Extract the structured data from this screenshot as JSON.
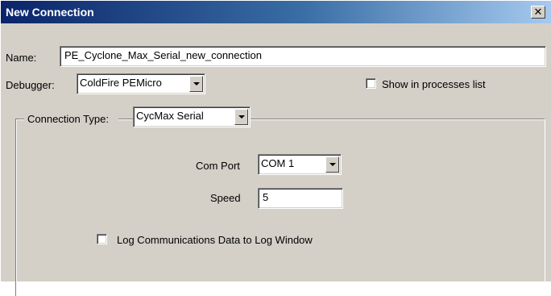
{
  "window": {
    "title": "New Connection",
    "close_glyph": "✕",
    "close_icon": "close-icon"
  },
  "form": {
    "name_label": "Name:",
    "name_value": "PE_Cyclone_Max_Serial_new_connection",
    "debugger_label": "Debugger:",
    "debugger_value": "ColdFire PEMicro",
    "show_in_processes_label": "Show in processes list",
    "show_in_processes_checked": false,
    "connection_type_label": "Connection Type:",
    "connection_type_value": "CycMax Serial",
    "com_port_label": "Com Port",
    "com_port_value": "COM 1",
    "speed_label": "Speed",
    "speed_value": "5",
    "log_label": "Log Communications Data to Log Window",
    "log_checked": false
  },
  "colors": {
    "face": "#d4d0c8",
    "title_start": "#0a246a",
    "title_end": "#a6caf0"
  }
}
